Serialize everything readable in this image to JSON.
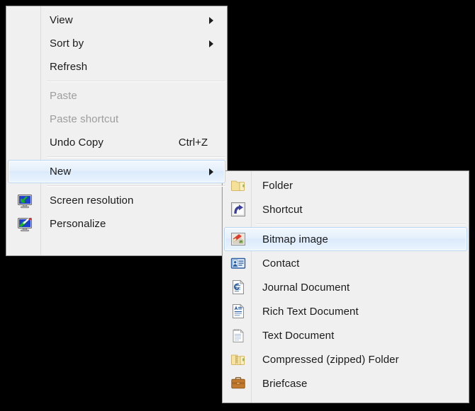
{
  "context_menu": {
    "name": "desktop-context-menu",
    "groups": [
      {
        "items": [
          {
            "label": "View",
            "icon": "",
            "accel": "",
            "submenu": true,
            "disabled": false,
            "selected": false
          },
          {
            "label": "Sort by",
            "icon": "",
            "accel": "",
            "submenu": true,
            "disabled": false,
            "selected": false
          },
          {
            "label": "Refresh",
            "icon": "",
            "accel": "",
            "submenu": false,
            "disabled": false,
            "selected": false
          }
        ]
      },
      {
        "items": [
          {
            "label": "Paste",
            "icon": "",
            "accel": "",
            "submenu": false,
            "disabled": true,
            "selected": false
          },
          {
            "label": "Paste shortcut",
            "icon": "",
            "accel": "",
            "submenu": false,
            "disabled": true,
            "selected": false
          },
          {
            "label": "Undo Copy",
            "icon": "",
            "accel": "Ctrl+Z",
            "submenu": false,
            "disabled": false,
            "selected": false
          }
        ]
      },
      {
        "items": [
          {
            "label": "New",
            "icon": "",
            "accel": "",
            "submenu": true,
            "disabled": false,
            "selected": true
          }
        ]
      },
      {
        "items": [
          {
            "label": "Screen resolution",
            "icon": "monitor-resolution-icon",
            "accel": "",
            "submenu": false,
            "disabled": false,
            "selected": false
          },
          {
            "label": "Personalize",
            "icon": "monitor-personalize-icon",
            "accel": "",
            "submenu": false,
            "disabled": false,
            "selected": false
          }
        ]
      }
    ]
  },
  "new_submenu": {
    "name": "new-submenu",
    "groups": [
      {
        "items": [
          {
            "label": "Folder",
            "icon": "folder-icon",
            "selected": false
          },
          {
            "label": "Shortcut",
            "icon": "shortcut-icon",
            "selected": false
          }
        ]
      },
      {
        "items": [
          {
            "label": "Bitmap image",
            "icon": "bitmap-image-icon",
            "selected": true
          },
          {
            "label": "Contact",
            "icon": "contact-icon",
            "selected": false
          },
          {
            "label": "Journal Document",
            "icon": "journal-document-icon",
            "selected": false
          },
          {
            "label": "Rich Text Document",
            "icon": "rich-text-document-icon",
            "selected": false
          },
          {
            "label": "Text Document",
            "icon": "text-document-icon",
            "selected": false
          },
          {
            "label": "Compressed (zipped) Folder",
            "icon": "zipped-folder-icon",
            "selected": false
          },
          {
            "label": "Briefcase",
            "icon": "briefcase-icon",
            "selected": false
          }
        ]
      }
    ]
  },
  "colors": {
    "menu_background": "#f0f0f0",
    "menu_border": "#9a9a9a",
    "text": "#1a1a1a",
    "disabled_text": "#9d9d9d",
    "highlight_border": "#b8d6f4",
    "separator": "#e0e0e0",
    "desktop_background": "#000000"
  }
}
